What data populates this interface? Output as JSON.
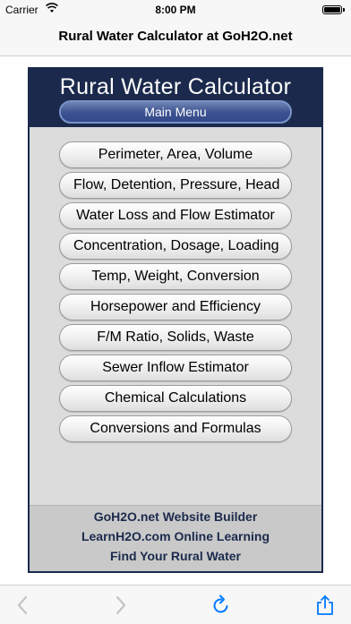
{
  "status_bar": {
    "carrier": "Carrier",
    "time": "8:00 PM",
    "icons": [
      "wifi-icon",
      "battery-icon"
    ]
  },
  "nav": {
    "title": "Rural Water Calculator at GoH2O.net"
  },
  "calculator": {
    "title": "Rural Water Calculator",
    "main_menu_label": "Main Menu",
    "menu_items": [
      "Perimeter, Area, Volume",
      "Flow, Detention, Pressure, Head",
      "Water Loss and Flow Estimator",
      "Concentration, Dosage, Loading",
      "Temp, Weight, Conversion",
      "Horsepower and Efficiency",
      "F/M Ratio, Solids, Waste",
      "Sewer Inflow Estimator",
      "Chemical Calculations",
      "Conversions and Formulas"
    ],
    "footer_links": [
      "GoH2O.net Website Builder",
      "LearnH2O.com Online Learning",
      "Find Your Rural Water"
    ],
    "colors": {
      "header": "#1b2a4c",
      "panel": "#dcdcdc",
      "footer": "#c9c9c9"
    }
  },
  "toolbar": {
    "icons": [
      "back-arrow-icon",
      "forward-arrow-icon",
      "reload-icon",
      "share-icon"
    ],
    "accent": "#007aff"
  }
}
